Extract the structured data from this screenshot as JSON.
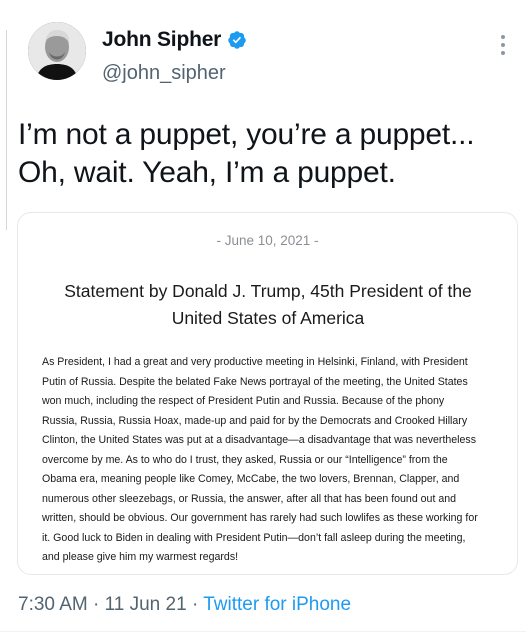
{
  "author": {
    "display_name": "John Sipher",
    "handle": "@john_sipher",
    "verified_icon": "verified-badge-icon",
    "avatar_icon": "profile-photo"
  },
  "tweet": {
    "lines": [
      "I’m not a puppet, you’re a puppet...",
      "Oh, wait. Yeah, I’m a puppet."
    ]
  },
  "statement": {
    "date": "- June 10, 2021 -",
    "title_lines": [
      "Statement by Donald J. Trump, 45th President of the",
      "United States of America"
    ],
    "body_lines": [
      "As President, I had a great and very productive meeting in Helsinki, Finland, with President",
      "Putin of Russia. Despite the belated Fake News portrayal of the meeting, the United States",
      "won much, including the respect of President Putin and Russia. Because of the phony",
      "Russia, Russia, Russia Hoax, made-up and paid for by the Democrats and Crooked Hillary",
      "Clinton, the United States was put at a disadvantage—a disadvantage that was nevertheless",
      "overcome by me. As to who do I trust, they asked, Russia or our “Intelligence” from the",
      "Obama era, meaning people like Comey, McCabe, the two lovers, Brennan, Clapper, and",
      "numerous other sleezebags, or Russia, the answer, after all that has been found out and",
      "written, should be obvious. Our government has rarely had such lowlifes as these working for",
      "it. Good luck to Biden in dealing with President Putin—don’t fall asleep during the meeting,",
      "and please give him my warmest regards!"
    ]
  },
  "meta": {
    "time": "7:30 AM",
    "separator": " · ",
    "date": "11 Jun 21",
    "source": "Twitter for iPhone"
  },
  "colors": {
    "verified": "#1d9bf0",
    "link": "#1d9bf0",
    "secondary_text": "#536471"
  },
  "icons": {
    "more": "more-options-icon"
  }
}
